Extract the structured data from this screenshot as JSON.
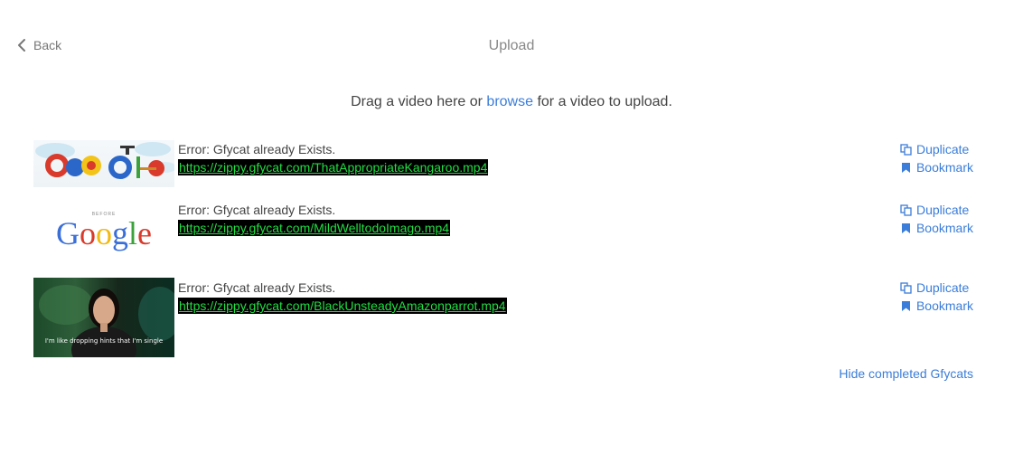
{
  "header": {
    "back_label": "Back",
    "title": "Upload"
  },
  "dropzone": {
    "prefix": "Drag a video here or ",
    "browse_label": "browse",
    "suffix": " for a video to upload."
  },
  "uploads": [
    {
      "thumbnail": "google-doodle-thumbnail",
      "error": "Error: Gfycat already Exists.",
      "url": "https://zippy.gfycat.com/ThatAppropriateKangaroo.mp4",
      "duplicate_label": "Duplicate",
      "bookmark_label": "Bookmark"
    },
    {
      "thumbnail": "google-logo-thumbnail",
      "thumb_caption": "BEFORE",
      "thumb_logo": "Google",
      "error": "Error: Gfycat already Exists.",
      "url": "https://zippy.gfycat.com/MildWelltodoImago.mp4",
      "duplicate_label": "Duplicate",
      "bookmark_label": "Bookmark"
    },
    {
      "thumbnail": "video-still-thumbnail",
      "thumb_subtitle": "I'm like dropping hints that I'm single",
      "error": "Error: Gfycat already Exists.",
      "url": "https://zippy.gfycat.com/BlackUnsteadyAmazonparrot.mp4",
      "duplicate_label": "Duplicate",
      "bookmark_label": "Bookmark"
    }
  ],
  "footer": {
    "hide_completed_label": "Hide completed Gfycats"
  },
  "colors": {
    "link": "#3b7dd8",
    "url_background": "#000000",
    "url_text": "#22dd44",
    "muted": "#777777"
  },
  "icons": {
    "back": "chevron-left-icon",
    "duplicate": "duplicate-icon",
    "bookmark": "bookmark-icon"
  }
}
